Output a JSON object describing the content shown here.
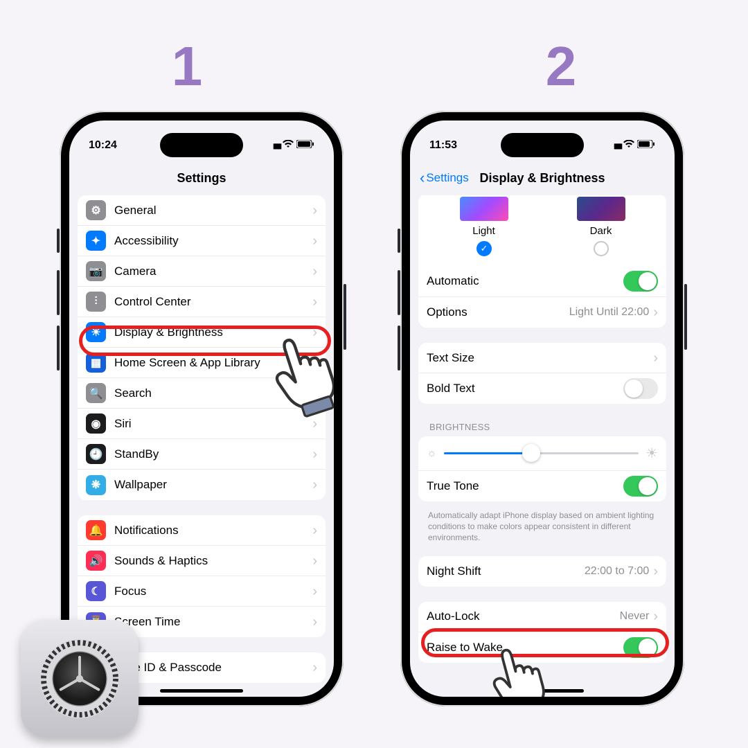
{
  "steps": {
    "1": "1",
    "2": "2"
  },
  "phone1": {
    "time": "10:24",
    "title": "Settings",
    "groupA": [
      {
        "label": "General",
        "icon": "gear-icon",
        "cls": "bg-grey",
        "glyph": "⚙"
      },
      {
        "label": "Accessibility",
        "icon": "accessibility-icon",
        "cls": "bg-blue",
        "glyph": "✦"
      },
      {
        "label": "Camera",
        "icon": "camera-icon",
        "cls": "bg-grey",
        "glyph": "📷"
      },
      {
        "label": "Control Center",
        "icon": "switches-icon",
        "cls": "bg-grey",
        "glyph": "⫶"
      },
      {
        "label": "Display & Brightness",
        "icon": "brightness-icon",
        "cls": "bg-blue",
        "glyph": "☀"
      },
      {
        "label": "Home Screen & App Library",
        "icon": "home-apps-icon",
        "cls": "bg-darkblue",
        "glyph": "▦"
      },
      {
        "label": "Search",
        "icon": "search-icon",
        "cls": "bg-grey",
        "glyph": "🔍"
      },
      {
        "label": "Siri",
        "icon": "siri-icon",
        "cls": "bg-black",
        "glyph": "◉"
      },
      {
        "label": "StandBy",
        "icon": "standby-icon",
        "cls": "bg-black",
        "glyph": "🕘"
      },
      {
        "label": "Wallpaper",
        "icon": "wallpaper-icon",
        "cls": "bg-cyan",
        "glyph": "❋"
      }
    ],
    "groupB": [
      {
        "label": "Notifications",
        "icon": "notifications-icon",
        "cls": "bg-red",
        "glyph": "🔔"
      },
      {
        "label": "Sounds & Haptics",
        "icon": "sounds-icon",
        "cls": "bg-pink",
        "glyph": "🔊"
      },
      {
        "label": "Focus",
        "icon": "focus-icon",
        "cls": "bg-purple",
        "glyph": "☾"
      },
      {
        "label": "Screen Time",
        "icon": "screen-time-icon",
        "cls": "bg-purple",
        "glyph": "⏳"
      }
    ],
    "groupC": [
      {
        "label": "Face ID & Passcode",
        "icon": "faceid-icon",
        "cls": "bg-grey",
        "glyph": "☻"
      }
    ]
  },
  "phone2": {
    "time": "11:53",
    "back": "Settings",
    "title": "Display & Brightness",
    "appearance": {
      "light": "Light",
      "dark": "Dark",
      "selected": "light"
    },
    "automatic": {
      "label": "Automatic",
      "on": true
    },
    "options": {
      "label": "Options",
      "detail": "Light Until 22:00"
    },
    "textsize": {
      "label": "Text Size"
    },
    "boldtext": {
      "label": "Bold Text",
      "on": false
    },
    "brightnessHeader": "BRIGHTNESS",
    "brightnessValue": 0.45,
    "truetone": {
      "label": "True Tone",
      "on": true
    },
    "truetoneFooter": "Automatically adapt iPhone display based on ambient lighting conditions to make colors appear consistent in different environments.",
    "nightshift": {
      "label": "Night Shift",
      "detail": "22:00 to 7:00"
    },
    "autolock": {
      "label": "Auto-Lock",
      "detail": "Never"
    },
    "raisetowake": {
      "label": "Raise to Wake",
      "on": true
    }
  }
}
